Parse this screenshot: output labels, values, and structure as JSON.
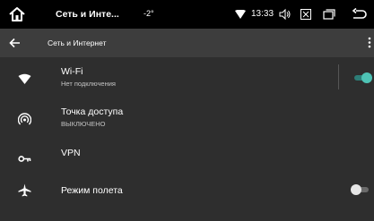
{
  "status_bar": {
    "title": "Сеть и Инте...",
    "temperature": "-2°",
    "time": "13:33",
    "icons": [
      "home-icon",
      "wifi-signal-icon",
      "volume-icon",
      "close-box-icon",
      "recent-apps-icon",
      "back-icon"
    ]
  },
  "app_bar": {
    "title": "Сеть и Интернет",
    "icons": [
      "arrow-left-icon",
      "more-vert-icon"
    ]
  },
  "settings": [
    {
      "id": "wifi",
      "title": "Wi-Fi",
      "subtitle": "Нет подключения",
      "icon": "wifi-icon",
      "toggle": true
    },
    {
      "id": "hotspot",
      "title": "Точка доступа",
      "subtitle": "ВЫКЛЮЧЕНО",
      "icon": "hotspot-icon"
    },
    {
      "id": "vpn",
      "title": "VPN",
      "icon": "key-icon"
    },
    {
      "id": "airplane",
      "title": "Режим полета",
      "icon": "airplane-icon",
      "toggle": false
    }
  ],
  "colors": {
    "background": "#2e2e2e",
    "status_bar": "#000000",
    "app_bar": "#3d3d3d",
    "toggle_on": "#4ec3b5"
  }
}
